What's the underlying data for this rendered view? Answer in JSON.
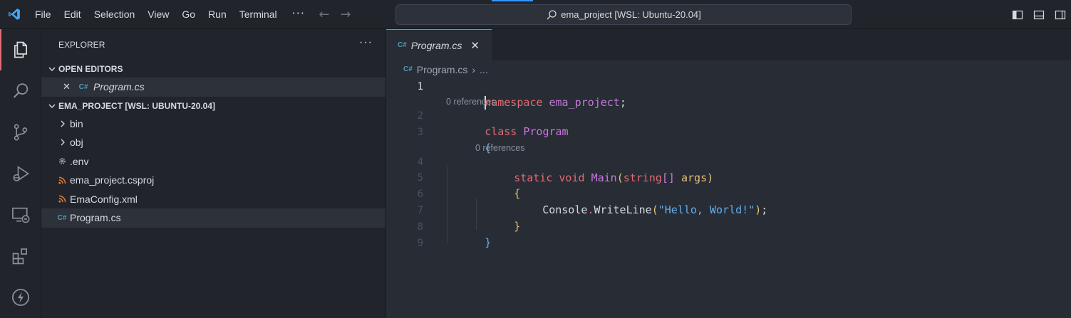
{
  "titlebar": {
    "menu": [
      "File",
      "Edit",
      "Selection",
      "View",
      "Go",
      "Run",
      "Terminal"
    ],
    "more": "···",
    "back": "←",
    "forward": "→",
    "command_center": "ema_project [WSL: Ubuntu-20.04]"
  },
  "sidebar": {
    "title": "EXPLORER",
    "more": "···",
    "open_editors": {
      "label": "OPEN EDITORS",
      "items": [
        {
          "close": "✕",
          "icon": "C#",
          "name": "Program.cs"
        }
      ]
    },
    "project": {
      "label": "EMA_PROJECT [WSL: UBUNTU-20.04]",
      "items": [
        {
          "kind": "folder",
          "name": "bin"
        },
        {
          "kind": "folder",
          "name": "obj"
        },
        {
          "kind": "gear",
          "name": ".env"
        },
        {
          "kind": "rss",
          "name": "ema_project.csproj"
        },
        {
          "kind": "rss",
          "name": "EmaConfig.xml"
        },
        {
          "kind": "cs",
          "name": "Program.cs"
        }
      ]
    }
  },
  "editor": {
    "tab": {
      "name": "Program.cs",
      "close": "✕",
      "icon": "C#"
    },
    "breadcrumb": {
      "file": "Program.cs",
      "sep": "›",
      "more": "..."
    },
    "codelens": [
      "0 references",
      "0 references"
    ],
    "line_numbers": [
      "1",
      "2",
      "3",
      "4",
      "5",
      "6",
      "7",
      "8",
      "9"
    ],
    "lines": {
      "l1": {
        "kw": "namespace",
        "name": "ema_project",
        "semi": ";"
      },
      "l2": {
        "kw": "class",
        "name": "Program"
      },
      "l3": {
        "brace": "{"
      },
      "l4": {
        "kw1": "static",
        "kw2": "void",
        "fn": "Main",
        "open": "(",
        "type": "string",
        "arr": "[]",
        "arg": "args",
        "close": ")"
      },
      "l5": {
        "brace": "{"
      },
      "l6": {
        "obj": "Console",
        "dot": ".",
        "fn": "WriteLine",
        "open": "(",
        "str": "\"Hello, World!\"",
        "close": ")",
        "semi": ";"
      },
      "l7": {
        "brace": "}"
      },
      "l8": {
        "brace": "}"
      }
    }
  },
  "colors": {
    "accent": "#e06c75",
    "background": "#282c34",
    "sidebar": "#21252b"
  }
}
